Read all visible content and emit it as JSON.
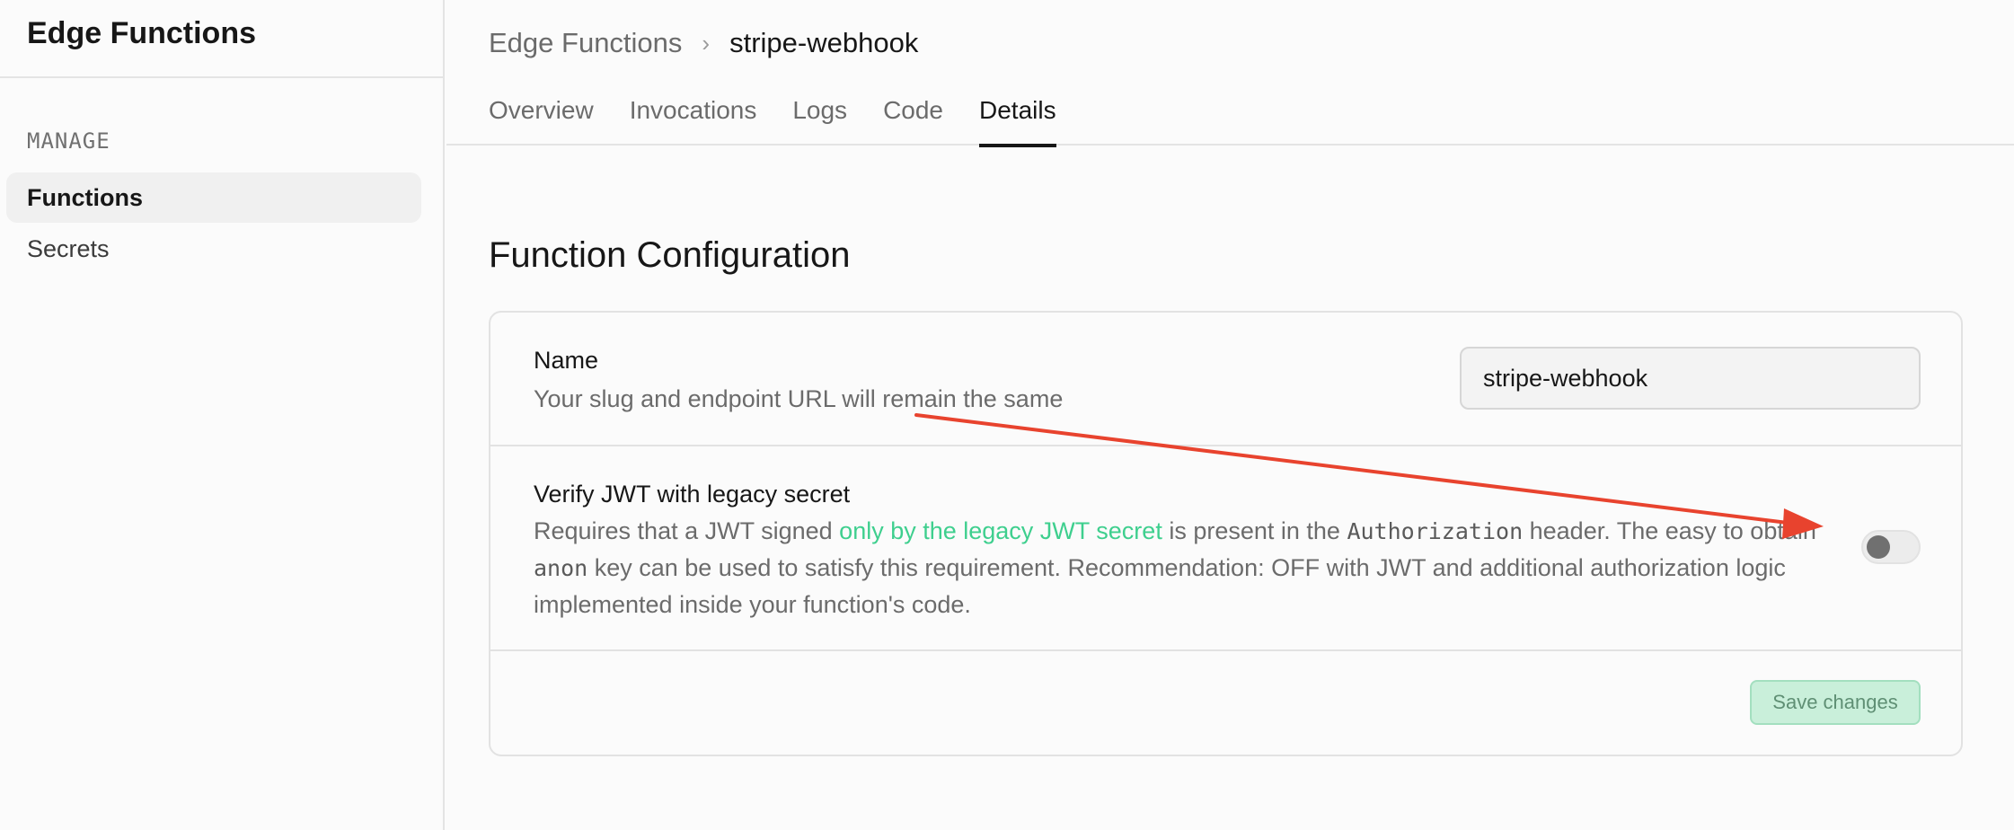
{
  "sidebar": {
    "title": "Edge Functions",
    "section_label": "MANAGE",
    "items": [
      {
        "label": "Functions"
      },
      {
        "label": "Secrets"
      }
    ]
  },
  "header": {
    "breadcrumb_root": "Edge Functions",
    "breadcrumb_separator": "›",
    "breadcrumb_current": "stripe-webhook",
    "tabs": [
      {
        "label": "Overview"
      },
      {
        "label": "Invocations"
      },
      {
        "label": "Logs"
      },
      {
        "label": "Code"
      },
      {
        "label": "Details"
      }
    ]
  },
  "main": {
    "section_title": "Function Configuration",
    "name_field": {
      "label": "Name",
      "description": "Your slug and endpoint URL will remain the same",
      "value": "stripe-webhook"
    },
    "jwt_field": {
      "label": "Verify JWT with legacy secret",
      "desc_part1": "Requires that a JWT signed ",
      "desc_link": "only by the legacy JWT secret",
      "desc_part2": " is present in the ",
      "desc_code1": "Authorization",
      "desc_part3": " header. The easy to obtain ",
      "desc_code2": "anon",
      "desc_part4": " key can be used to satisfy this requirement. Recommendation: OFF with JWT and additional authorization logic implemented inside your function's code.",
      "toggle_on": false
    },
    "save_label": "Save changes"
  },
  "colors": {
    "accent": "#3ecf8e",
    "annotation_arrow": "#e8432e"
  }
}
